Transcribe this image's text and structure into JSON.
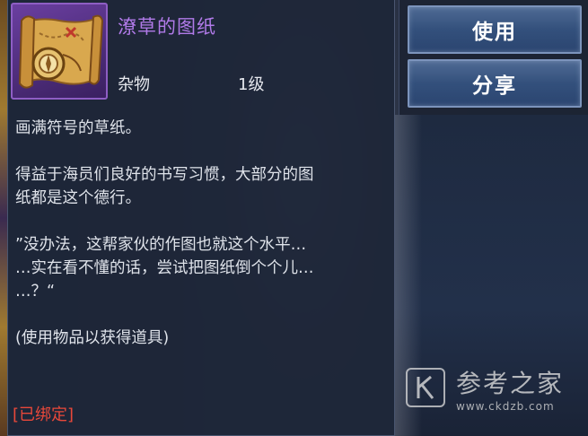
{
  "item": {
    "name": "潦草的图纸",
    "type": "杂物",
    "level": "1级",
    "icon": "treasure-map-scroll-icon",
    "name_color": "#b07ae8"
  },
  "description": {
    "line1": "画满符号的草纸。",
    "line2a": "得益于海员们良好的书写习惯，大部分的图",
    "line2b": "纸都是这个德行。",
    "line3a": "”没办法，这帮家伙的作图也就这个水平…",
    "line3b": "…实在看不懂的话，尝试把图纸倒个个儿…",
    "line3c": "…？“",
    "line4": "(使用物品以获得道具)"
  },
  "bound_label": "[已绑定]",
  "bound_color": "#e8483a",
  "buttons": {
    "use": "使用",
    "share": "分享"
  },
  "watermark": {
    "title": "参考之家",
    "url": "www.ckdzb.com",
    "icon": "k-logo-icon"
  }
}
